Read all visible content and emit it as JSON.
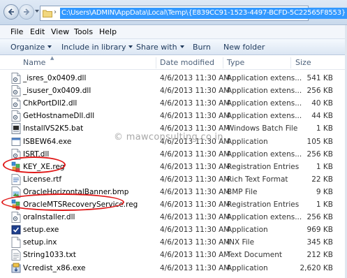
{
  "address_bar": {
    "path": "C:\\Users\\ADMIN\\AppData\\Local\\Temp\\{E839CC91-1523-4497-BCFD-5C22565F8553}"
  },
  "menu": {
    "items": [
      "File",
      "Edit",
      "View",
      "Tools",
      "Help"
    ]
  },
  "toolbar": {
    "organize": "Organize",
    "include_in_library": "Include in library",
    "share_with": "Share with",
    "burn": "Burn",
    "new_folder": "New folder"
  },
  "columns": {
    "name": "Name",
    "date_modified": "Date modified",
    "type": "Type",
    "size": "Size"
  },
  "files": [
    {
      "name": "_isres_0x0409.dll",
      "date": "4/6/2013 11:30 AM",
      "type": "Application extens...",
      "size": "541 KB",
      "icon": "dll-icon"
    },
    {
      "name": "_isuser_0x0409.dll",
      "date": "4/6/2013 11:30 AM",
      "type": "Application extens...",
      "size": "256 KB",
      "icon": "dll-icon"
    },
    {
      "name": "ChkPortDll2.dll",
      "date": "4/6/2013 11:30 AM",
      "type": "Application extens...",
      "size": "40 KB",
      "icon": "dll-icon"
    },
    {
      "name": "GetHostnameDll.dll",
      "date": "4/6/2013 11:30 AM",
      "type": "Application extens...",
      "size": "44 KB",
      "icon": "dll-icon"
    },
    {
      "name": "InstallVS2K5.bat",
      "date": "4/6/2013 11:30 AM",
      "type": "Windows Batch File",
      "size": "1 KB",
      "icon": "batch-icon"
    },
    {
      "name": "ISBEW64.exe",
      "date": "4/6/2013 11:30 AM",
      "type": "Application",
      "size": "105 KB",
      "icon": "exe-icon"
    },
    {
      "name": "ISRT.dll",
      "date": "4/6/2013 11:30 AM",
      "type": "Application extens...",
      "size": "256 KB",
      "icon": "dll-icon"
    },
    {
      "name": "KEY_XE.reg",
      "date": "4/6/2013 11:30 AM",
      "type": "Registration Entries",
      "size": "1 KB",
      "icon": "registry-icon"
    },
    {
      "name": "License.rtf",
      "date": "4/6/2013 11:30 AM",
      "type": "Rich Text Format",
      "size": "22 KB",
      "icon": "rtf-icon"
    },
    {
      "name": "OracleHorizontalBanner.bmp",
      "date": "4/6/2013 11:30 AM",
      "type": "BMP File",
      "size": "9 KB",
      "icon": "bmp-icon"
    },
    {
      "name": "OracleMTSRecoveryService.reg",
      "date": "4/6/2013 11:30 AM",
      "type": "Registration Entries",
      "size": "1 KB",
      "icon": "registry-icon"
    },
    {
      "name": "oraInstaller.dll",
      "date": "4/6/2013 11:30 AM",
      "type": "Application extens...",
      "size": "256 KB",
      "icon": "dll-icon"
    },
    {
      "name": "setup.exe",
      "date": "4/6/2013 11:30 AM",
      "type": "Application",
      "size": "969 KB",
      "icon": "setup-exe-icon"
    },
    {
      "name": "setup.inx",
      "date": "4/6/2013 11:30 AM",
      "type": "INX File",
      "size": "345 KB",
      "icon": "file-icon"
    },
    {
      "name": "String1033.txt",
      "date": "4/6/2013 11:30 AM",
      "type": "Text Document",
      "size": "212 KB",
      "icon": "text-file-icon"
    },
    {
      "name": "Vcredist_x86.exe",
      "date": "4/6/2013 11:30 AM",
      "type": "Application",
      "size": "2,620 KB",
      "icon": "installer-exe-icon"
    }
  ],
  "watermark": "© mawconsulting.co.in",
  "colors": {
    "selection": "#3399ff",
    "annotation_ring": "#e01818",
    "toolbar_text": "#1e395b"
  }
}
